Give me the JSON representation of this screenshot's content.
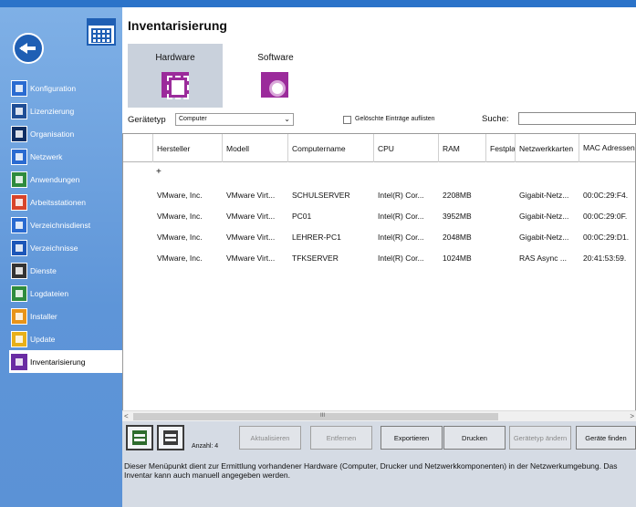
{
  "page": {
    "title": "Inventarisierung"
  },
  "sidebar": {
    "items": [
      {
        "label": "Konfiguration",
        "icon": "gear-icon"
      },
      {
        "label": "Lizenzierung",
        "icon": "license-icon"
      },
      {
        "label": "Organisation",
        "icon": "building-icon"
      },
      {
        "label": "Netzwerk",
        "icon": "network-icon"
      },
      {
        "label": "Anwendungen",
        "icon": "application-window-icon"
      },
      {
        "label": "Arbeitsstationen",
        "icon": "workstation-icon"
      },
      {
        "label": "Verzeichnisdienst",
        "icon": "directory-service-icon"
      },
      {
        "label": "Verzeichnisse",
        "icon": "folder-icon"
      },
      {
        "label": "Dienste",
        "icon": "services-icon"
      },
      {
        "label": "Logdateien",
        "icon": "log-file-icon"
      },
      {
        "label": "Installer",
        "icon": "installer-download-icon"
      },
      {
        "label": "Update",
        "icon": "update-icon"
      },
      {
        "label": "Inventarisierung",
        "icon": "inventory-icon"
      }
    ]
  },
  "tabs": {
    "hardware": "Hardware",
    "software": "Software"
  },
  "filters": {
    "device_type_label": "Gerätetyp",
    "device_type_value": "Computer",
    "show_deleted_label": "Gelöschte Einträge auflisten",
    "search_label": "Suche:"
  },
  "grid": {
    "columns": [
      "Hersteller",
      "Modell",
      "Computername",
      "CPU",
      "RAM",
      "Festpla",
      "Netzwerkkarten",
      "MAC Adressen"
    ],
    "new_row_mark": "+",
    "rows": [
      [
        "VMware, Inc.",
        "VMware Virt...",
        "SCHULSERVER",
        "Intel(R) Cor...",
        "2208MB",
        "",
        "Gigabit-Netz...",
        "00:0C:29:F4."
      ],
      [
        "VMware, Inc.",
        "VMware Virt...",
        "PC01",
        "Intel(R) Cor...",
        "3952MB",
        "",
        "Gigabit-Netz...",
        "00:0C:29:0F."
      ],
      [
        "VMware, Inc.",
        "VMware Virt...",
        "LEHRER-PC1",
        "Intel(R) Cor...",
        "2048MB",
        "",
        "Gigabit-Netz...",
        "00:0C:29:D1."
      ],
      [
        "VMware, Inc.",
        "VMware Virt...",
        "TFKSERVER",
        "Intel(R) Cor...",
        "1024MB",
        "",
        "RAS Async ...",
        "20:41:53:59."
      ]
    ]
  },
  "scrollbar": {
    "left": "<",
    "grip": "III",
    "right": ">"
  },
  "footer": {
    "count_label": "Anzahl: 4",
    "buttons": {
      "refresh": "Aktualisieren",
      "remove": "Entfernen",
      "export": "Exportieren",
      "print": "Drucken",
      "change_type": "Gerätetyp ändern",
      "find_devices": "Geräte finden"
    },
    "status": "Dieser Menüpunkt dient zur Ermittlung vorhandener Hardware (Computer, Drucker und Netzwerkkomponenten) in der Netzwerkumgebung. Das Inventar kann auch manuell angegeben werden."
  },
  "colors": {
    "accent": "#2b73c9",
    "sidebar": "#6a9fdf",
    "inventory_purple": "#9b2b9b"
  }
}
